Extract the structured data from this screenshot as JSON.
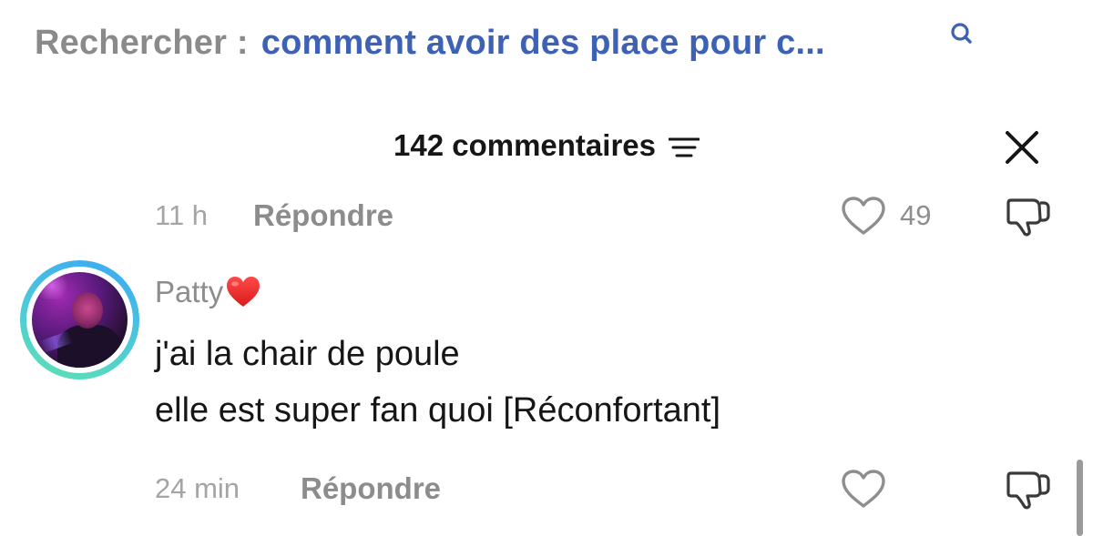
{
  "search": {
    "prefix": "Rechercher :",
    "query": "comment avoir des place pour c...",
    "icon": "search-icon"
  },
  "comments_header": {
    "count_label": "142 commentaires",
    "sort_icon": "sort-lines-icon",
    "close_icon": "close-icon"
  },
  "previous_comment": {
    "time": "11 h",
    "reply_label": "Répondre",
    "likes": "49"
  },
  "comment": {
    "author": "Patty",
    "author_emoji": "red-heart",
    "lines": [
      "j'ai la chair de poule",
      "elle est super fan quoi [Réconfortant]"
    ],
    "time": "24 min",
    "reply_label": "Répondre"
  },
  "colors": {
    "search_query": "#3d61b4",
    "muted_text": "#8d8d8d",
    "primary_text": "#161616",
    "avatar_ring": "#4cc7dc"
  }
}
